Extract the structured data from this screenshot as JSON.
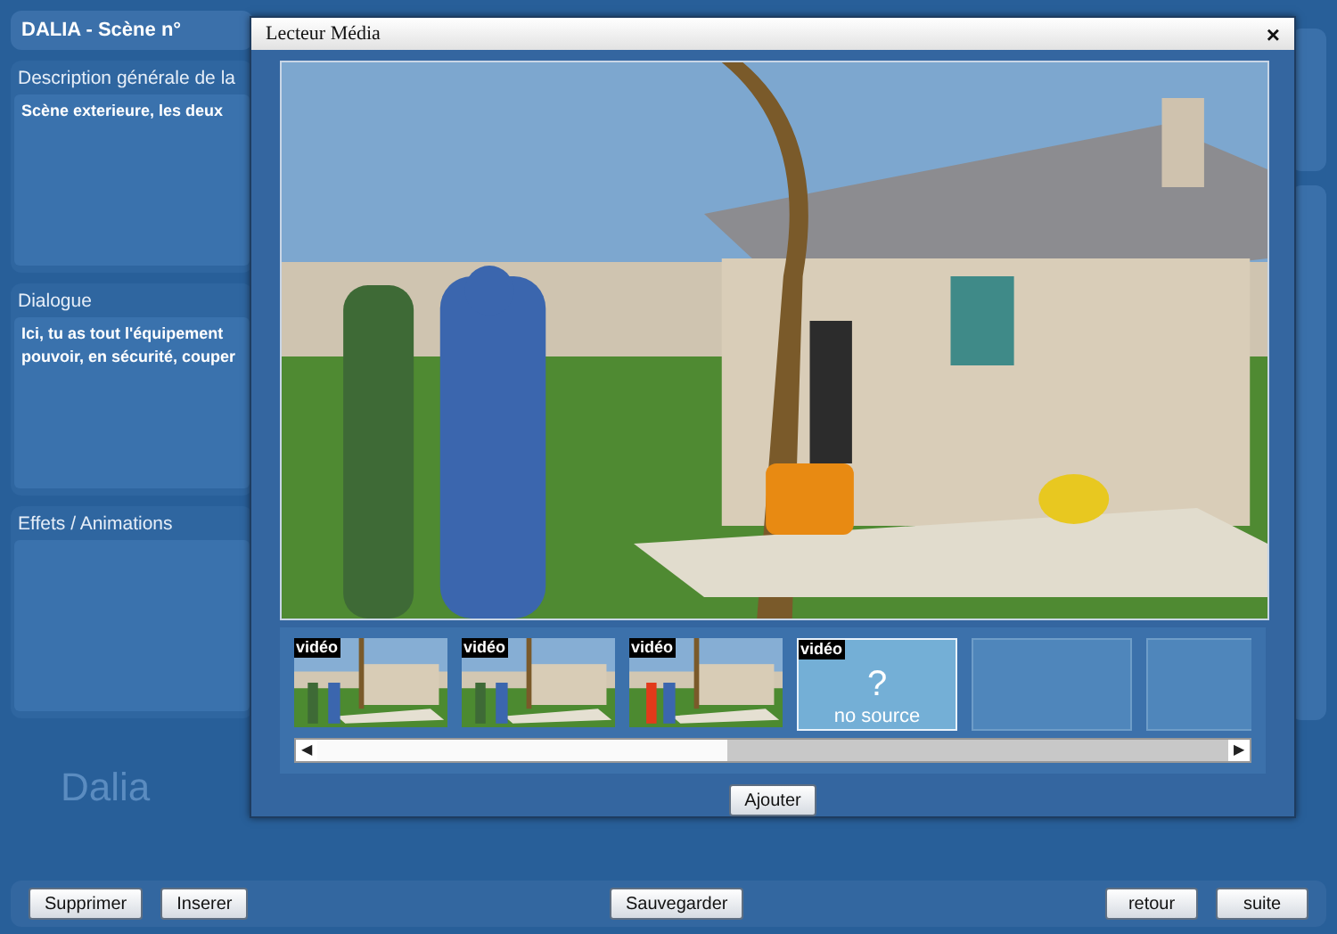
{
  "app": {
    "title": "DALIA - Scène n°",
    "logo": "Dalia"
  },
  "panels": [
    {
      "title": "Description générale de la",
      "text": "Scène exterieure, les deux"
    },
    {
      "title": "Dialogue",
      "text": "Ici, tu as tout l'équipement pouvoir, en sécurité, couper"
    },
    {
      "title": "Effets / Animations"
    }
  ],
  "modal": {
    "title": "Lecteur Média",
    "close": "×",
    "thumbnails": [
      {
        "kind": "video",
        "label": "vidéo"
      },
      {
        "kind": "video",
        "label": "vidéo"
      },
      {
        "kind": "video",
        "label": "vidéo"
      },
      {
        "kind": "empty",
        "label": "vidéo",
        "mark": "?",
        "caption": "no source",
        "selected": true
      },
      {
        "kind": "blank"
      },
      {
        "kind": "blank"
      }
    ],
    "scroll_left": "◀",
    "scroll_right": "▶",
    "add_button": "Ajouter"
  },
  "footer": {
    "left_buttons": [
      "Supprimer",
      "Inserer"
    ],
    "center_button": "Sauvegarder",
    "right_buttons": [
      "retour",
      "suite"
    ]
  }
}
